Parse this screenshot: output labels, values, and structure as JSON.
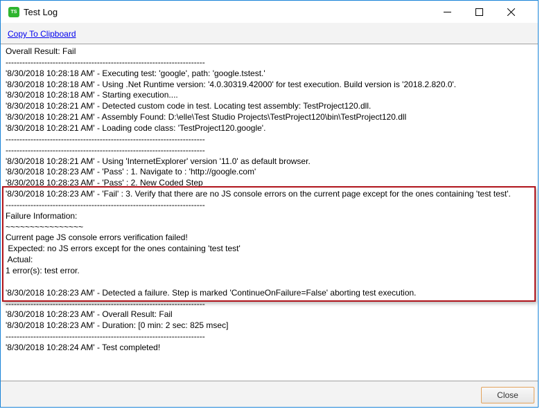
{
  "window": {
    "title": "Test Log",
    "app_icon_text": "TS",
    "controls": {
      "minimize": "minimize-icon",
      "maximize": "maximize-icon",
      "close": "close-icon"
    }
  },
  "toolbar": {
    "copy_label": "Copy To Clipboard"
  },
  "log": {
    "lines": [
      "Overall Result: Fail",
      "------------------------------------------------------------------------",
      "'8/30/2018 10:28:18 AM' - Executing test: 'google', path: 'google.tstest.'",
      "'8/30/2018 10:28:18 AM' - Using .Net Runtime version: '4.0.30319.42000' for test execution. Build version is '2018.2.820.0'.",
      "'8/30/2018 10:28:18 AM' - Starting execution....",
      "'8/30/2018 10:28:21 AM' - Detected custom code in test. Locating test assembly: TestProject120.dll.",
      "'8/30/2018 10:28:21 AM' - Assembly Found: D:\\elle\\Test Studio Projects\\TestProject120\\bin\\TestProject120.dll",
      "'8/30/2018 10:28:21 AM' - Loading code class: 'TestProject120.google'.",
      "------------------------------------------------------------------------",
      "------------------------------------------------------------------------",
      "'8/30/2018 10:28:21 AM' - Using 'InternetExplorer' version '11.0' as default browser.",
      "'8/30/2018 10:28:23 AM' - 'Pass' : 1. Navigate to : 'http://google.com'",
      "'8/30/2018 10:28:23 AM' - 'Pass' : 2. New Coded Step",
      "'8/30/2018 10:28:23 AM' - 'Fail' : 3. Verify that there are no JS console errors on the current page except for the ones containing 'test test'.",
      "------------------------------------------------------------------------",
      "Failure Information:",
      "~~~~~~~~~~~~~~~~",
      "Current page JS console errors verification failed!",
      " Expected: no JS errors except for the ones containing 'test test'",
      " Actual:",
      "1 error(s): test error.",
      "",
      "'8/30/2018 10:28:23 AM' - Detected a failure. Step is marked 'ContinueOnFailure=False' aborting test execution.",
      "------------------------------------------------------------------------",
      "'8/30/2018 10:28:23 AM' - Overall Result: Fail",
      "'8/30/2018 10:28:23 AM' - Duration: [0 min: 2 sec: 825 msec]",
      "------------------------------------------------------------------------",
      "'8/30/2018 10:28:24 AM' - Test completed!"
    ],
    "highlight_color": "#b0141b"
  },
  "footer": {
    "close_label": "Close"
  }
}
